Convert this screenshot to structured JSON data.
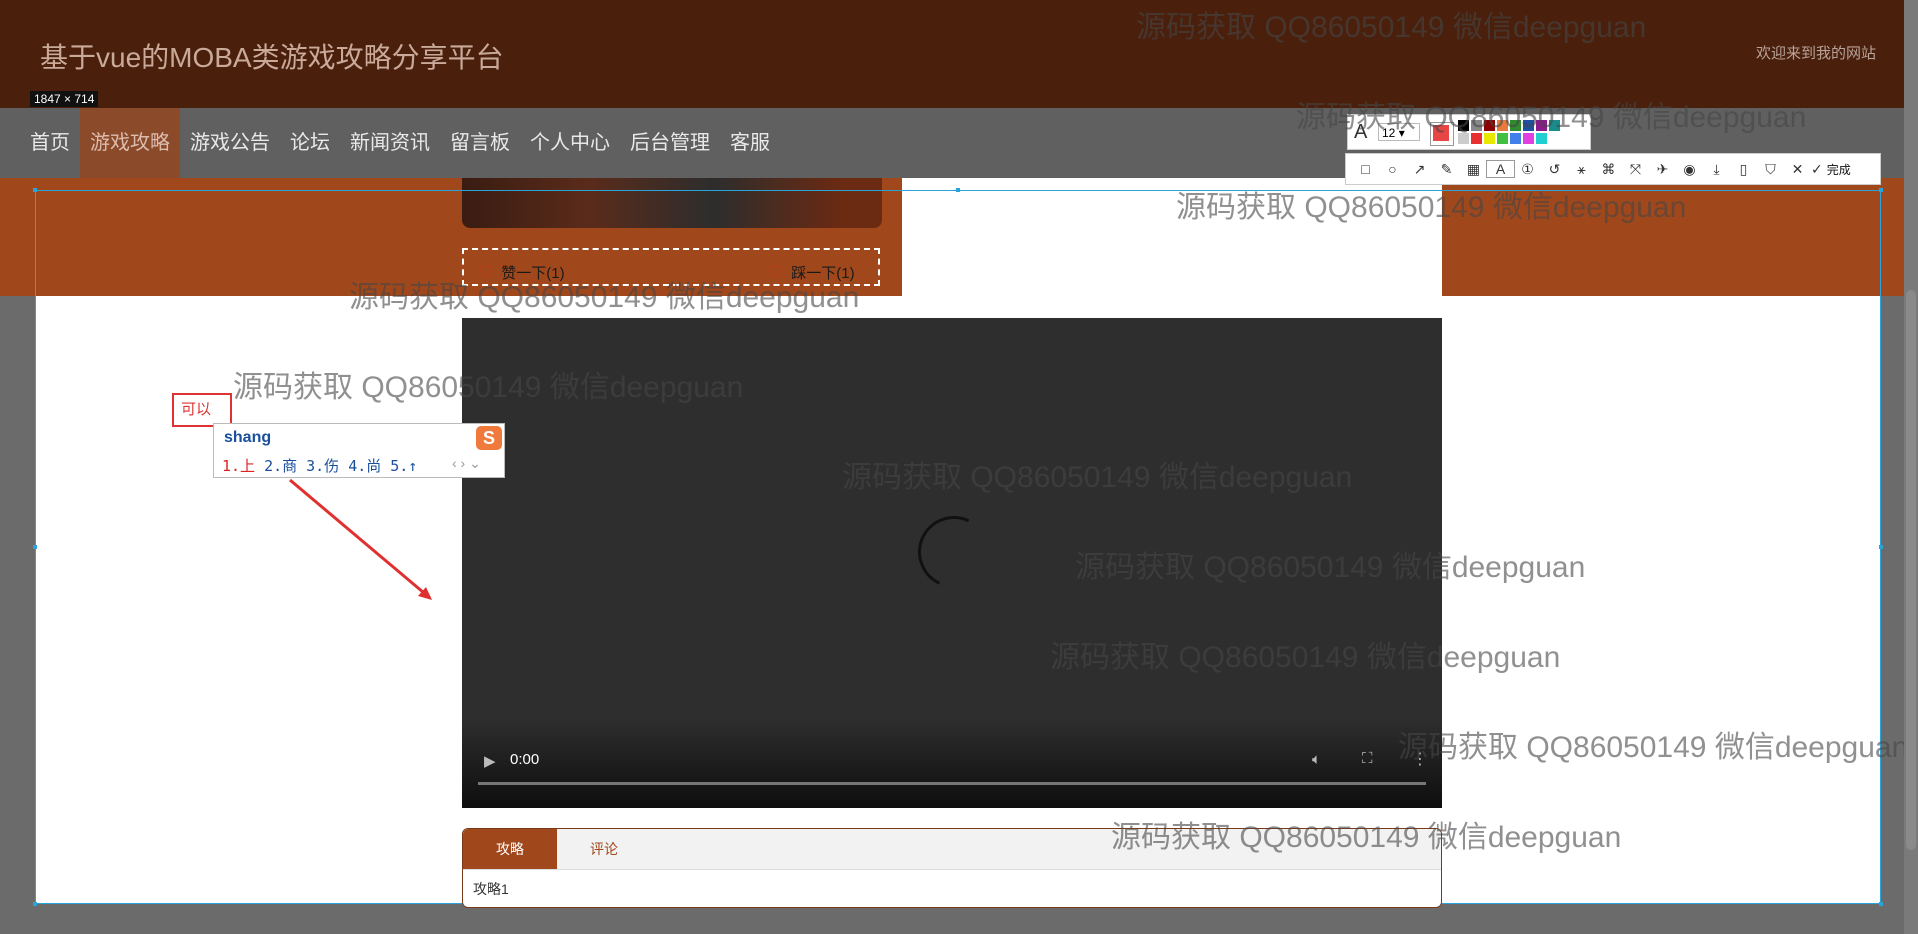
{
  "header": {
    "site_title": "基于vue的MOBA类游戏攻略分享平台",
    "welcome": "欢迎来到我的网站",
    "dimension_tag": "1847 × 714"
  },
  "nav": {
    "items": [
      "首页",
      "游戏攻略",
      "游戏公告",
      "论坛",
      "新闻资讯",
      "留言板",
      "个人中心",
      "后台管理",
      "客服"
    ],
    "active_index": 1
  },
  "votes": {
    "like": "赞一下(1)",
    "dislike": "踩一下(1)"
  },
  "video": {
    "time": "0:00",
    "progress": 0
  },
  "tabs": {
    "items": [
      "攻略",
      "评论"
    ],
    "active": "攻略",
    "content": "攻略1"
  },
  "annotation": {
    "note": "可以",
    "ime_input": "shang",
    "ime_candidates": [
      "1.上",
      "2.商",
      "3.伤",
      "4.尚",
      "5.↑"
    ],
    "ime_logo": "S"
  },
  "toolbar": {
    "font_size": "12",
    "finish_label": "完成",
    "active_color": "#e84545",
    "palette": [
      "#000000",
      "#888888",
      "#8b0000",
      "#e87a3c",
      "#2e8b2e",
      "#1f4fa0",
      "#8b1a8b",
      "#1a8b8b",
      "#ffffff",
      "#cccccc",
      "#e83030",
      "#e8e800",
      "#40c040",
      "#4080e8",
      "#e040e0",
      "#20d0d0"
    ]
  },
  "watermark": "源码获取 QQ86050149 微信deepguan"
}
